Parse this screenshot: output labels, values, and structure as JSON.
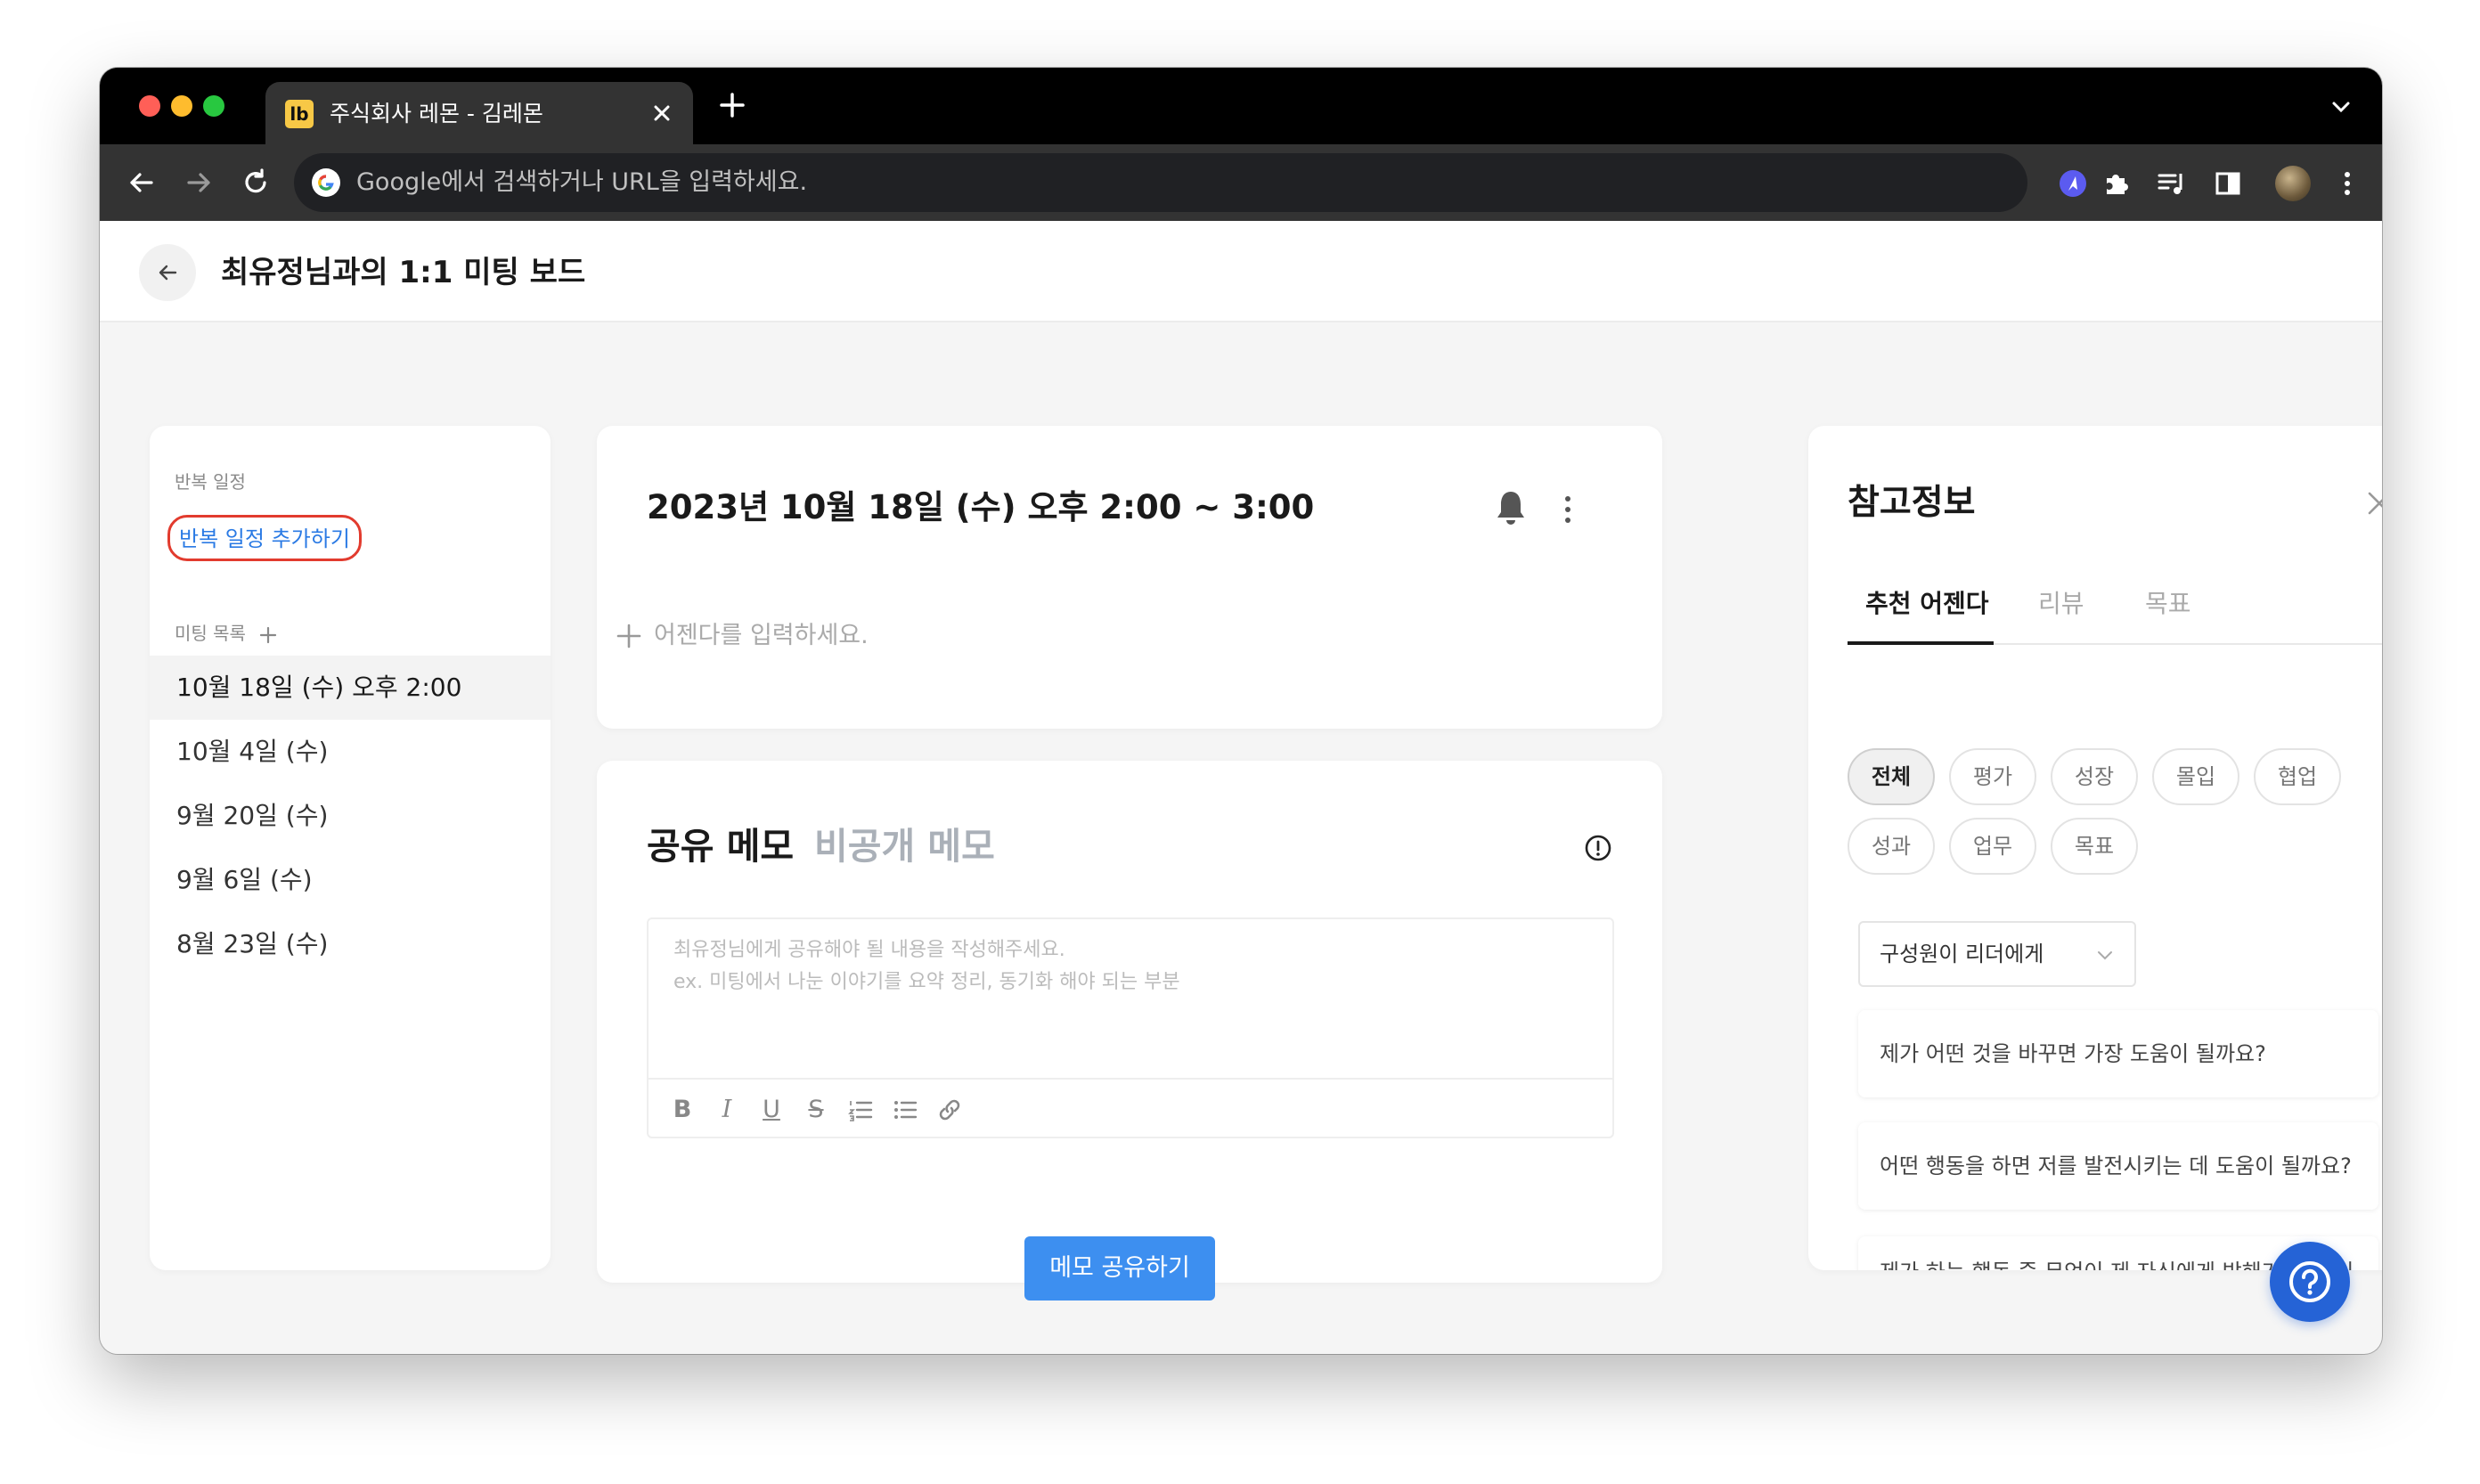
{
  "browser": {
    "tab_title": "주식회사 레몬 - 김레몬",
    "tab_favicon_text": "lb",
    "address_placeholder": "Google에서 검색하거나 URL을 입력하세요.",
    "colors": {
      "tabbar": "#000000",
      "toolbar": "#333333",
      "omnibox": "#202124"
    }
  },
  "header": {
    "title": "최유정님과의 1:1 미팅 보드"
  },
  "left_panel": {
    "recurring_label": "반복 일정",
    "recurring_link": "반복 일정 추가하기",
    "meetings_label": "미팅 목록",
    "meetings": [
      {
        "label": "10월 18일 (수) 오후 2:00",
        "active": true
      },
      {
        "label": "10월 4일 (수)",
        "active": false
      },
      {
        "label": "9월 20일 (수)",
        "active": false
      },
      {
        "label": "9월 6일 (수)",
        "active": false
      },
      {
        "label": "8월 23일 (수)",
        "active": false
      }
    ]
  },
  "agenda": {
    "title": "2023년 10월 18일 (수) 오후 2:00 ~ 3:00",
    "placeholder": "어젠다를 입력하세요."
  },
  "memo": {
    "tab_shared": "공유 메모",
    "tab_private": "비공개 메모",
    "placeholder_line1": "최유정님에게 공유해야 될 내용을 작성해주세요.",
    "placeholder_line2": "ex. 미팅에서 나눈 이야기를 요약 정리, 동기화 해야 되는 부분",
    "toolbar": {
      "bold": "B",
      "italic": "I",
      "underline": "U",
      "strike": "S"
    },
    "share_button": "메모 공유하기"
  },
  "reference": {
    "title": "참고정보",
    "tabs": [
      "추천 어젠다",
      "리뷰",
      "목표"
    ],
    "chips": [
      "전체",
      "평가",
      "성장",
      "몰입",
      "협업",
      "성과",
      "업무",
      "목표"
    ],
    "select_value": "구성원이 리더에게",
    "questions": [
      "제가 어떤 것을 바꾸면 가장 도움이 될까요?",
      "어떤 행동을 하면 저를 발전시키는 데 도움이 될까요?",
      "제가 하는 행동 중 무엇이 제 자신에게 방해가 되고 있다고 생각하나요? 저의 그런 행동이 당신에게는 어떤 영향을 미쳤나요?"
    ]
  },
  "colors": {
    "accent": "#3d8ff0",
    "link": "#2a7ae4",
    "highlight": "#e23b2e",
    "help_fab": "#2563d6"
  }
}
